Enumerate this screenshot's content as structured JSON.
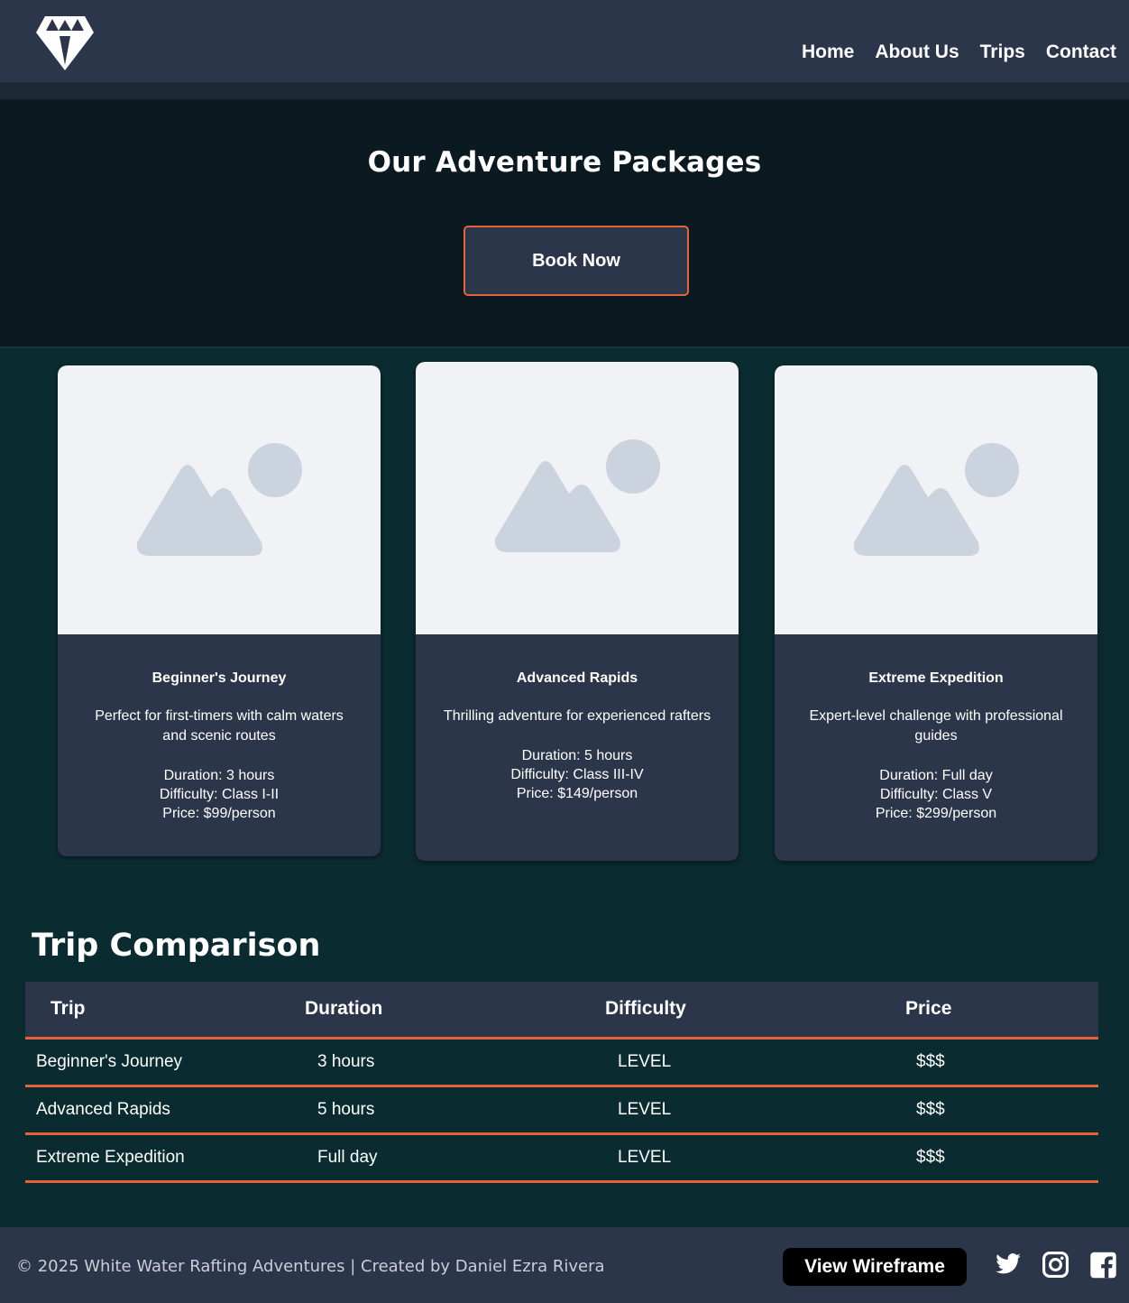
{
  "nav": {
    "home": "Home",
    "about": "About Us",
    "trips": "Trips",
    "contact": "Contact"
  },
  "hero": {
    "title": "Our Adventure Packages",
    "book_label": "Book Now"
  },
  "cards": [
    {
      "title": "Beginner's Journey",
      "desc": "Perfect for first-timers with calm waters and scenic routes",
      "duration": "Duration: 3 hours",
      "difficulty": "Difficulty: Class I-II",
      "price": "Price: $99/person"
    },
    {
      "title": "Advanced Rapids",
      "desc": "Thrilling adventure for experienced rafters",
      "duration": "Duration: 5 hours",
      "difficulty": "Difficulty: Class III-IV",
      "price": "Price: $149/person"
    },
    {
      "title": "Extreme Expedition",
      "desc": "Expert-level challenge with professional guides",
      "duration": "Duration: Full day",
      "difficulty": "Difficulty: Class V",
      "price": "Price: $299/person"
    }
  ],
  "comparison": {
    "title": "Trip Comparison",
    "headers": [
      "Trip",
      "Duration",
      "Difficulty",
      "Price"
    ],
    "rows": [
      [
        "Beginner's Journey",
        "3 hours",
        "LEVEL",
        "$$$"
      ],
      [
        "Advanced Rapids",
        "5 hours",
        "LEVEL",
        "$$$"
      ],
      [
        "Extreme Expedition",
        "Full day",
        "LEVEL",
        "$$$"
      ]
    ]
  },
  "footer": {
    "copyright": "© 2025 White Water Rafting Adventures | Created by Daniel Ezra Rivera",
    "wireframe_label": "View Wireframe",
    "social_icons": [
      "twitter-icon",
      "instagram-icon",
      "facebook-icon"
    ]
  },
  "colors": {
    "accent": "#e5623a",
    "panel": "#2b364a",
    "page_bg": "#0a2c30",
    "hero_bg": "#0a1a20"
  }
}
